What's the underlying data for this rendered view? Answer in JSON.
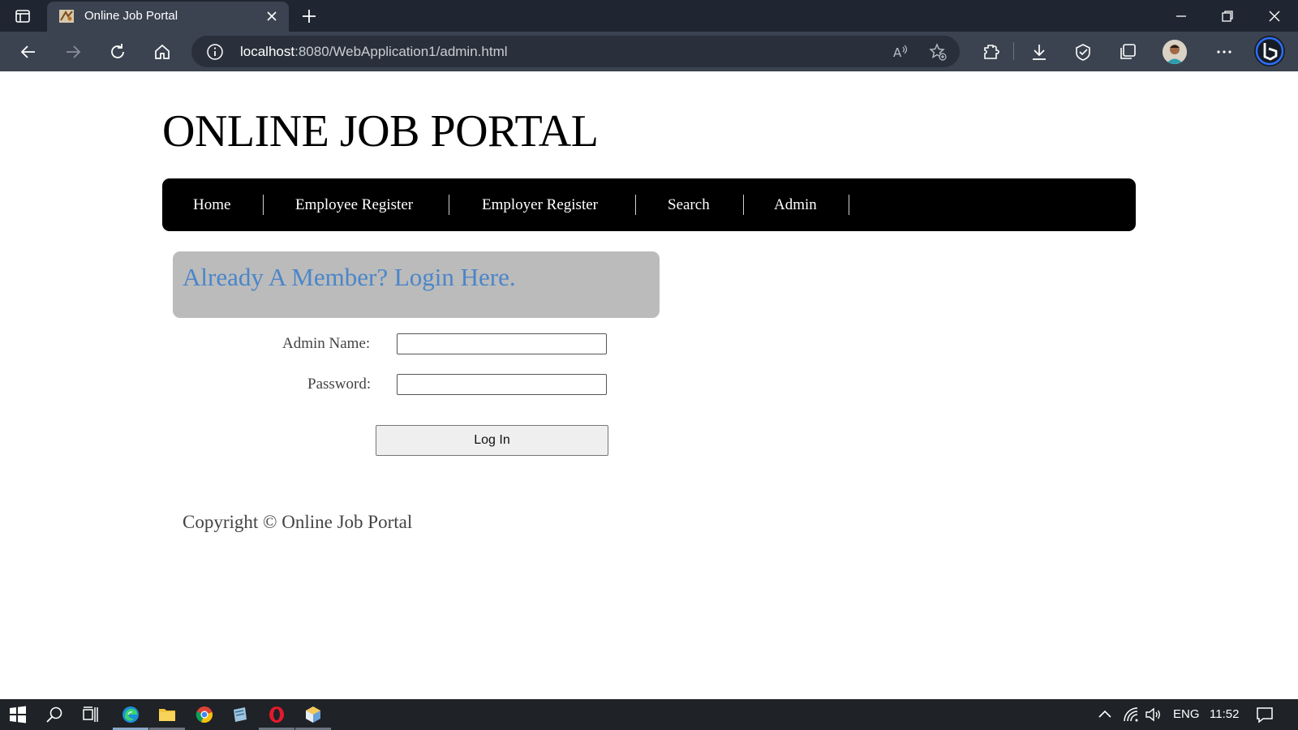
{
  "browser": {
    "tab_title": "Online Job Portal",
    "url_host": "localhost",
    "url_path": ":8080/WebApplication1/admin.html"
  },
  "site": {
    "title": "ONLINE JOB PORTAL",
    "nav": [
      "Home",
      "Employee Register",
      "Employer Register",
      "Search",
      "Admin"
    ]
  },
  "login": {
    "heading": "Already A Member? Login Here.",
    "admin_name_label": "Admin Name:",
    "admin_name_value": "",
    "password_label": "Password:",
    "password_value": "",
    "submit_label": "Log In"
  },
  "footer": {
    "copyright": "Copyright © Online Job Portal"
  },
  "taskbar": {
    "language": "ENG",
    "time": "11:52"
  },
  "colors": {
    "nav_bg": "#000000",
    "login_head_bg": "#bbbbbb",
    "login_head_text": "#4a86c9",
    "browser_tabbar": "#202631",
    "browser_toolbar": "#3b4350"
  }
}
